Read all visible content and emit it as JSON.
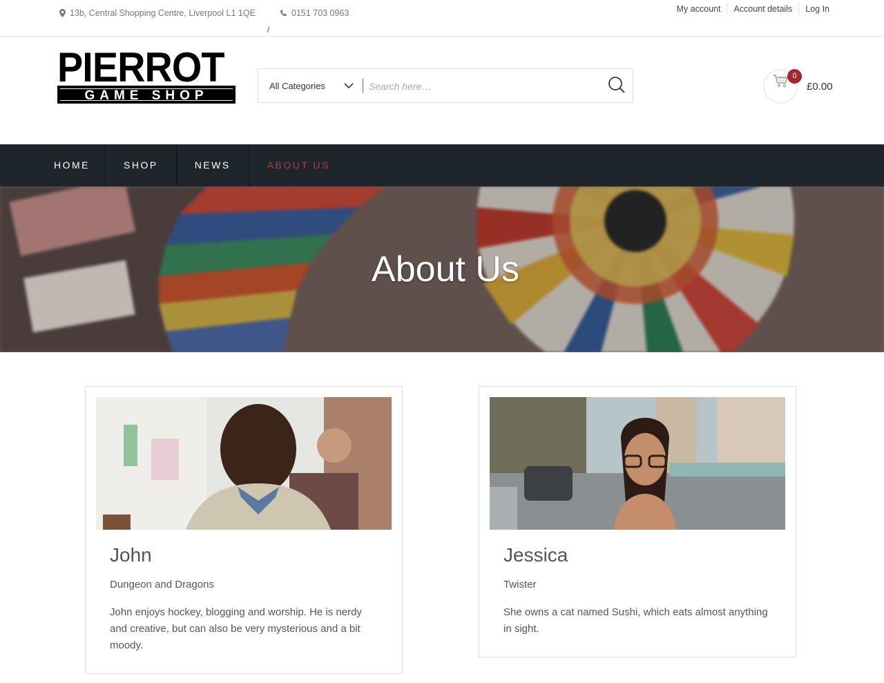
{
  "topbar": {
    "address": "13b, Central Shopping Centre, Liverpool L1 1QE",
    "phone": "0151 703 0963",
    "slash": "/",
    "links": [
      "My account",
      "Account details",
      "Log In"
    ]
  },
  "logo": {
    "line1": "PIERROT",
    "line2": "GAME SHOP"
  },
  "search": {
    "category": "All Categories",
    "placeholder": "Search here…"
  },
  "cart": {
    "count": "0",
    "total": "£0.00"
  },
  "nav": {
    "items": [
      "HOME",
      "SHOP",
      "NEWS",
      "ABOUT US"
    ],
    "active": "ABOUT US"
  },
  "hero": {
    "title": "About Us"
  },
  "team": [
    {
      "name": "John",
      "game": "Dungeon and Dragons",
      "bio": "John enjoys hockey, blogging and worship. He is nerdy and creative, but can also be very mysterious and a bit moody."
    },
    {
      "name": "Jessica",
      "game": "Twister",
      "bio": "She owns a cat named Sushi, which eats almost anything in sight."
    }
  ],
  "colors": {
    "accent": "#a6262f",
    "nav_bg": "#1e262b",
    "nav_active": "#b33a3e"
  }
}
